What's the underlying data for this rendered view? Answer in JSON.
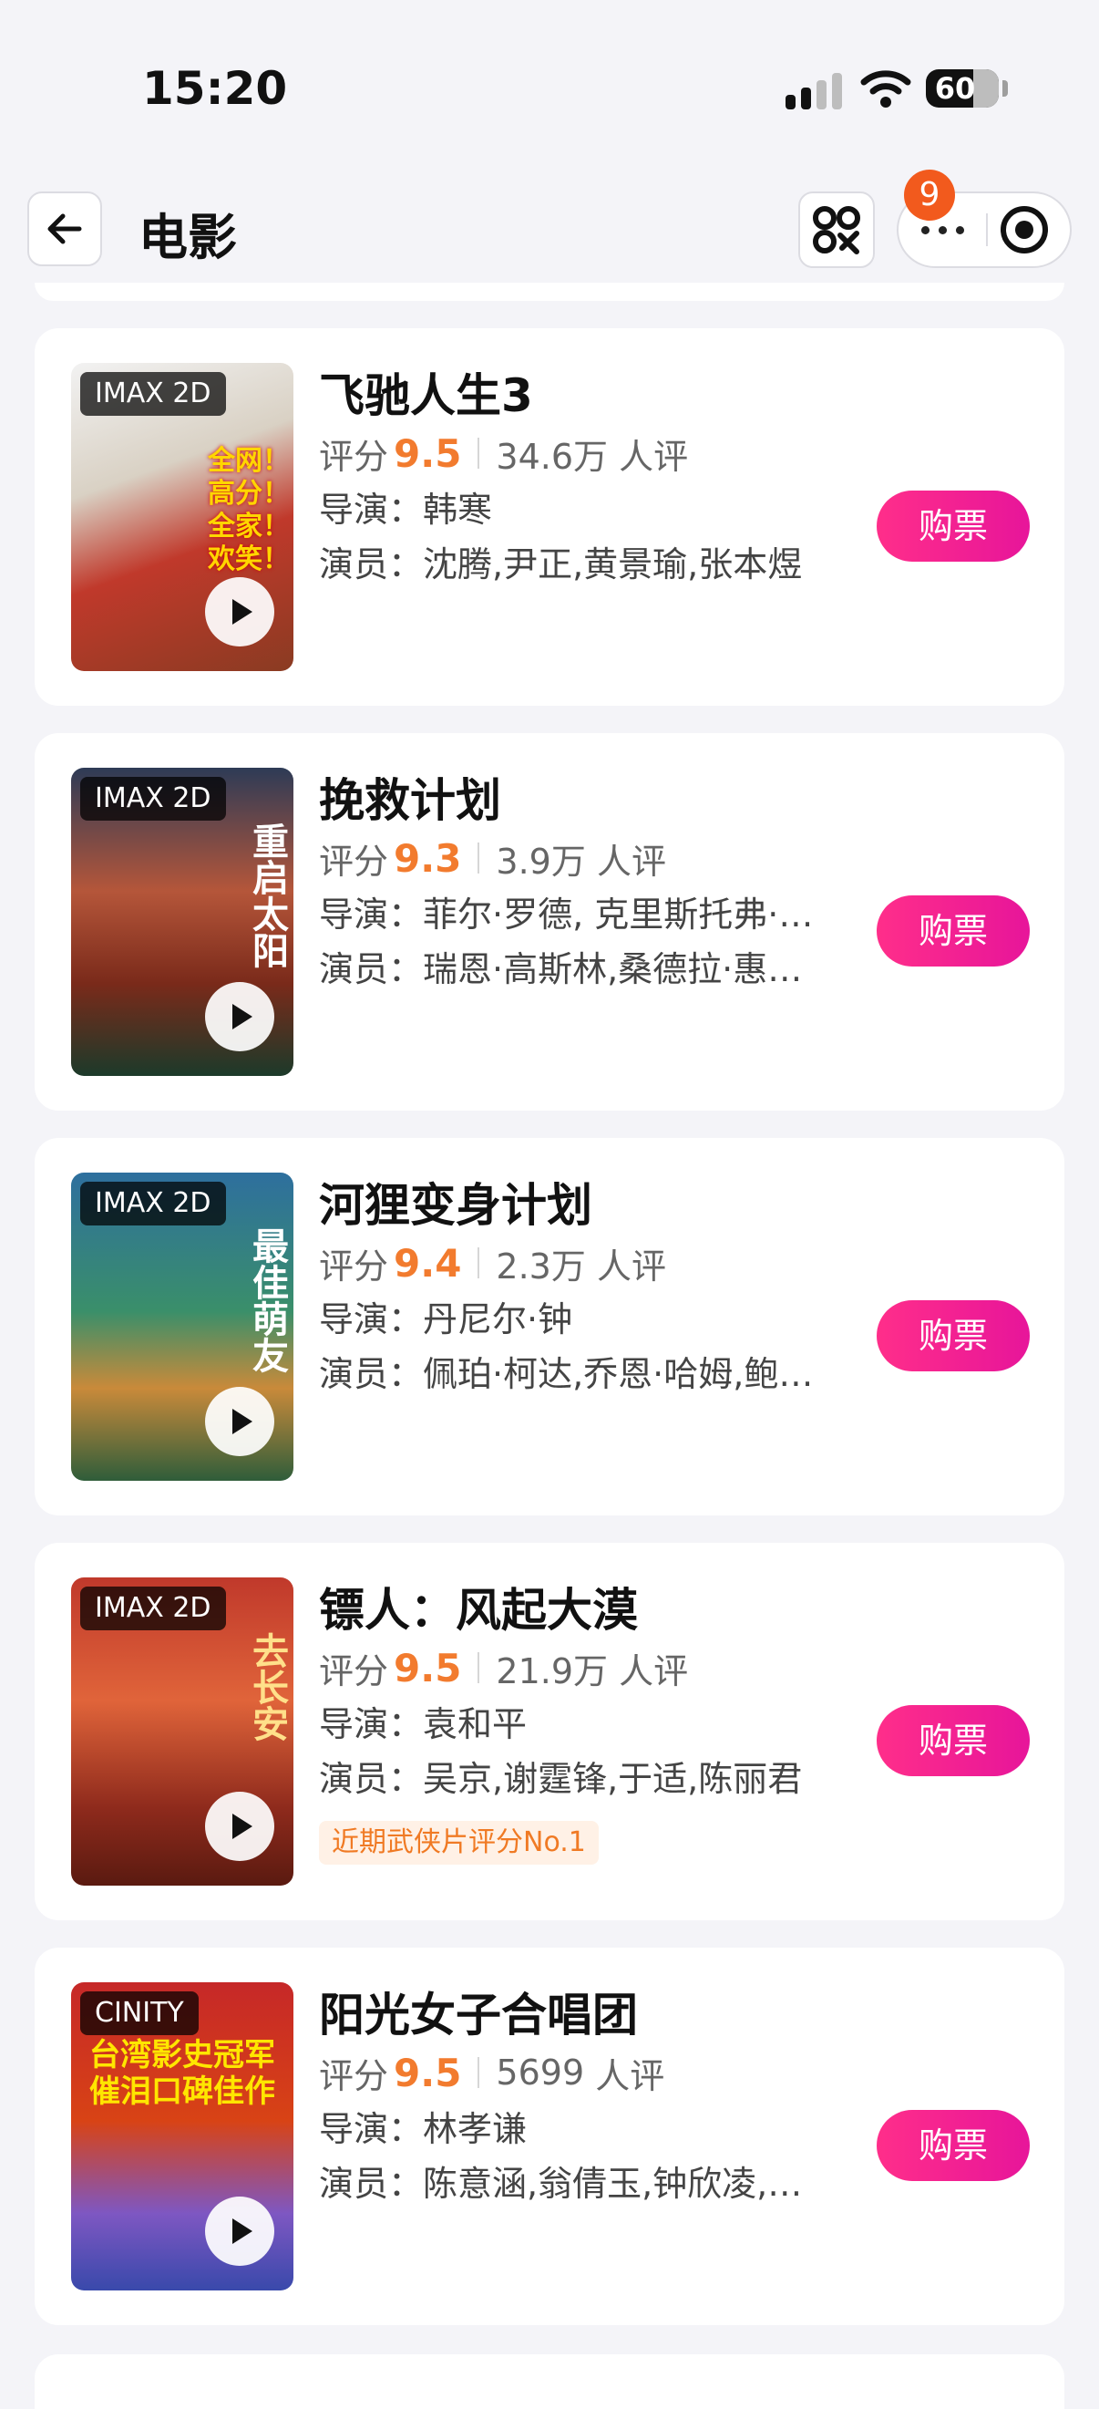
{
  "status_bar": {
    "time": "15:20",
    "battery": "60"
  },
  "nav": {
    "title": "电影",
    "badge_count": "9"
  },
  "labels": {
    "rating_prefix": "评分",
    "reviews_suffix": "人评",
    "director_prefix": "导演：",
    "cast_prefix": "演员：",
    "buy": "购票"
  },
  "colors": {
    "accent_score": "#f27b2e",
    "buy_button": "#ff2e8a",
    "badge": "#f25a1d"
  },
  "movies": [
    {
      "title": "飞驰人生3",
      "tag": "IMAX 2D",
      "score": "9.5",
      "reviews": "34.6万",
      "director": "韩寒",
      "cast": "沈腾,尹正,黄景瑜,张本煜",
      "poster_text": "全网！高分！全家！欢笑！"
    },
    {
      "title": "挽救计划",
      "tag": "IMAX 2D",
      "score": "9.3",
      "reviews": "3.9万",
      "director": "菲尔·罗德, 克里斯托弗·…",
      "cast": "瑞恩·高斯林,桑德拉·惠…",
      "poster_text": "重启太阳"
    },
    {
      "title": "河狸变身计划",
      "tag": "IMAX 2D",
      "score": "9.4",
      "reviews": "2.3万",
      "director": "丹尼尔·钟",
      "cast": "佩珀·柯达,乔恩·哈姆,鲍…",
      "poster_text": "最佳萌友"
    },
    {
      "title": "镖人：风起大漠",
      "tag": "IMAX 2D",
      "score": "9.5",
      "reviews": "21.9万",
      "director": "袁和平",
      "cast": "吴京,谢霆锋,于适,陈丽君",
      "highlight": "近期武侠片评分No.1",
      "poster_text": "去长安"
    },
    {
      "title": "阳光女子合唱团",
      "tag": "CINITY",
      "score": "9.5",
      "reviews": "5699",
      "director": "林孝谦",
      "cast": "陈意涵,翁倩玉,钟欣凌,…",
      "poster_text": "台湾影史冠军催泪口碑佳作"
    }
  ]
}
